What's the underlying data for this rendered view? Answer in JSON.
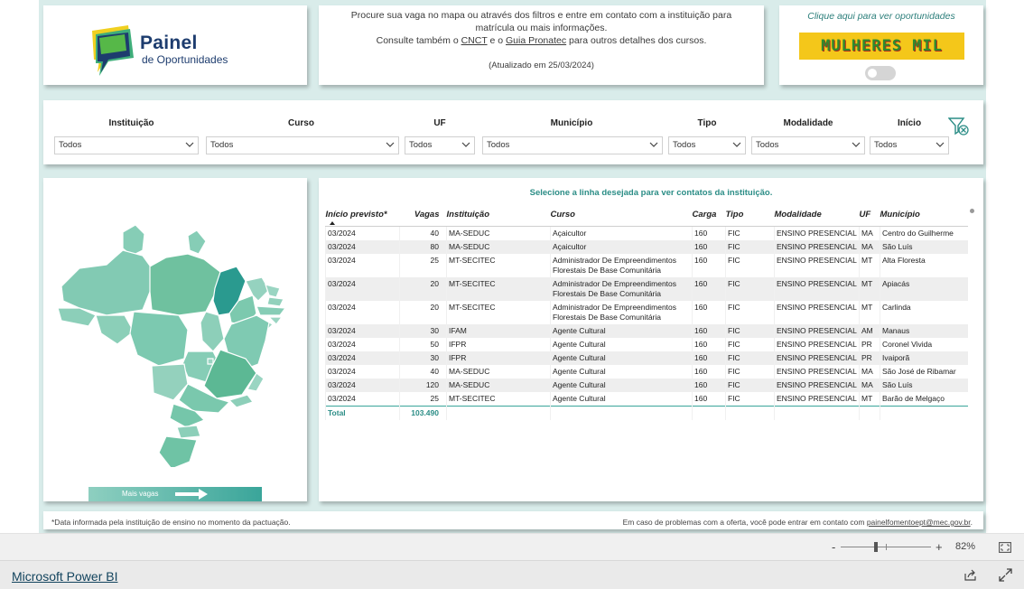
{
  "logo": {
    "title": "Painel",
    "subtitle": "de Oportunidades"
  },
  "info": {
    "line1": "Procure sua vaga no mapa ou através dos filtros e entre em contato com a instituição para",
    "line2": "matrícula ou mais informações.",
    "line3_pre": "Consulte também o ",
    "line3_link1": "CNCT",
    "line3_mid": " e o ",
    "line3_link2": "Guia Pronatec",
    "line3_post": " para outros detalhes dos cursos.",
    "updated": "(Atualizado em 25/03/2024)"
  },
  "promo": {
    "link_text": "Clique aqui para ver oportunidades",
    "banner_text": "MULHERES MIL",
    "colors": {
      "banner_bg": "#f4c71a",
      "banner_text": "#2e8b2e",
      "banner_shadow": "#b22a1a"
    }
  },
  "filters": [
    {
      "label": "Instituição",
      "value": "Todos"
    },
    {
      "label": "Curso",
      "value": "Todos"
    },
    {
      "label": "UF",
      "value": "Todos"
    },
    {
      "label": "Município",
      "value": "Todos"
    },
    {
      "label": "Tipo",
      "value": "Todos"
    },
    {
      "label": "Modalidade",
      "value": "Todos"
    },
    {
      "label": "Início",
      "value": "Todos"
    }
  ],
  "map": {
    "legend": "Mais vagas",
    "highlight_color": "#2a9a8f",
    "base_color": "#7fcab5"
  },
  "table": {
    "hint": "Selecione a linha desejada para ver contatos da instituição.",
    "columns": [
      "Início previsto*",
      "Vagas",
      "Instituição",
      "Curso",
      "Carga",
      "Tipo",
      "Modalidade",
      "UF",
      "Município"
    ],
    "rows": [
      [
        "03/2024",
        "40",
        "MA-SEDUC",
        "Açaicultor",
        "160",
        "FIC",
        "ENSINO PRESENCIAL",
        "MA",
        "Centro do Guilherme"
      ],
      [
        "03/2024",
        "80",
        "MA-SEDUC",
        "Açaicultor",
        "160",
        "FIC",
        "ENSINO PRESENCIAL",
        "MA",
        "São Luís"
      ],
      [
        "03/2024",
        "25",
        "MT-SECITEC",
        "Administrador De Empreendimentos Florestais De Base Comunitária",
        "160",
        "FIC",
        "ENSINO PRESENCIAL",
        "MT",
        "Alta Floresta"
      ],
      [
        "03/2024",
        "20",
        "MT-SECITEC",
        "Administrador De Empreendimentos Florestais De Base Comunitária",
        "160",
        "FIC",
        "ENSINO PRESENCIAL",
        "MT",
        "Apiacás"
      ],
      [
        "03/2024",
        "20",
        "MT-SECITEC",
        "Administrador De Empreendimentos Florestais De Base Comunitária",
        "160",
        "FIC",
        "ENSINO PRESENCIAL",
        "MT",
        "Carlinda"
      ],
      [
        "03/2024",
        "30",
        "IFAM",
        "Agente Cultural",
        "160",
        "FIC",
        "ENSINO PRESENCIAL",
        "AM",
        "Manaus"
      ],
      [
        "03/2024",
        "50",
        "IFPR",
        "Agente Cultural",
        "160",
        "FIC",
        "ENSINO PRESENCIAL",
        "PR",
        "Coronel Vivida"
      ],
      [
        "03/2024",
        "30",
        "IFPR",
        "Agente Cultural",
        "160",
        "FIC",
        "ENSINO PRESENCIAL",
        "PR",
        "Ivaiporã"
      ],
      [
        "03/2024",
        "40",
        "MA-SEDUC",
        "Agente Cultural",
        "160",
        "FIC",
        "ENSINO PRESENCIAL",
        "MA",
        "São José de Ribamar"
      ],
      [
        "03/2024",
        "120",
        "MA-SEDUC",
        "Agente Cultural",
        "160",
        "FIC",
        "ENSINO PRESENCIAL",
        "MA",
        "São Luís"
      ],
      [
        "03/2024",
        "25",
        "MT-SECITEC",
        "Agente Cultural",
        "160",
        "FIC",
        "ENSINO PRESENCIAL",
        "MT",
        "Barão de Melgaço"
      ]
    ],
    "total_label": "Total",
    "total_value": "103.490"
  },
  "footer": {
    "note": "*Data informada pela instituição de ensino no momento da pactuação.",
    "contact_pre": "Em caso de problemas com a oferta, você pode entrar em contato com ",
    "contact_email": "painelfomentoept@mec.gov.br",
    "contact_post": "."
  },
  "zoom": {
    "minus": "-",
    "plus": "+",
    "level": "82%"
  },
  "powerbi": {
    "link": "Microsoft Power BI"
  }
}
